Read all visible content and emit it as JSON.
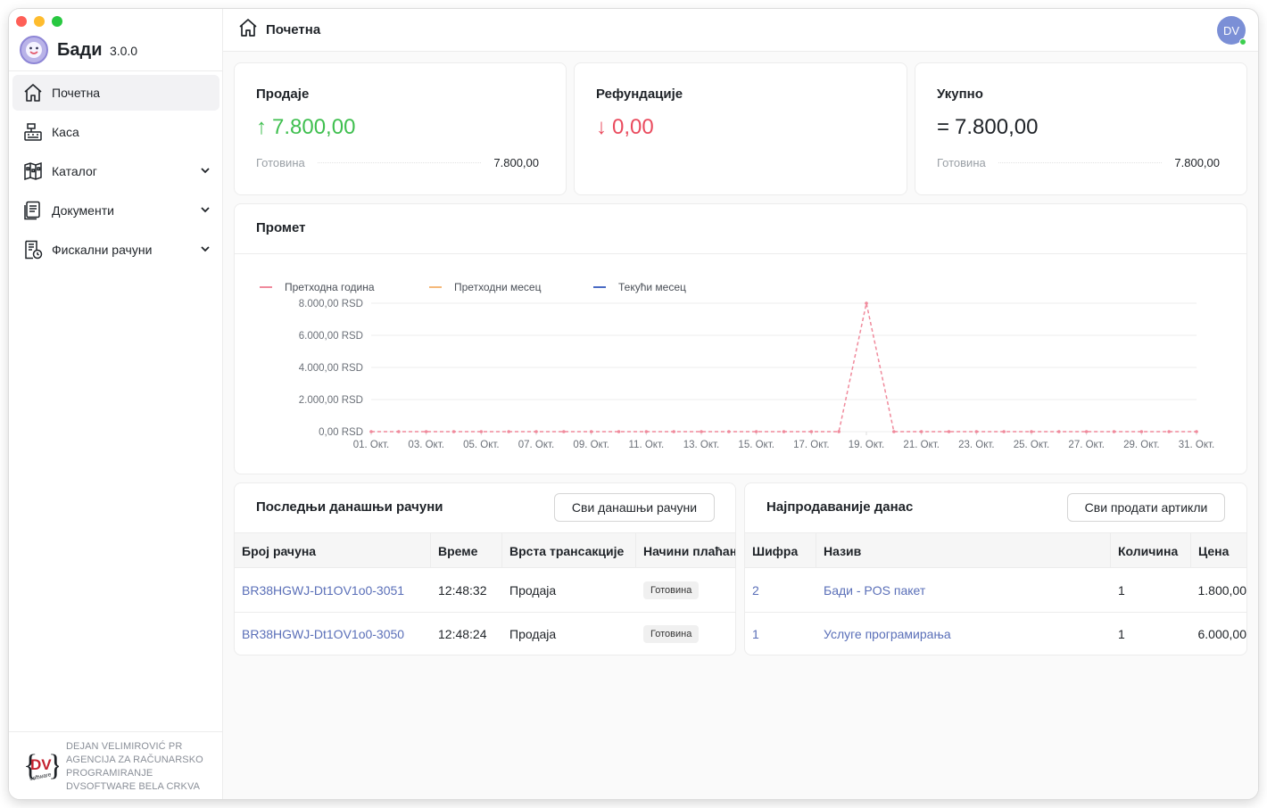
{
  "app": {
    "name": "Бади",
    "version": "3.0.0"
  },
  "nav": [
    {
      "label": "Почетна",
      "icon": "home-icon",
      "active": true,
      "expandable": false
    },
    {
      "label": "Каса",
      "icon": "cash-register-icon",
      "active": false,
      "expandable": false
    },
    {
      "label": "Каталог",
      "icon": "catalog-icon",
      "active": false,
      "expandable": true
    },
    {
      "label": "Документи",
      "icon": "documents-icon",
      "active": false,
      "expandable": true
    },
    {
      "label": "Фискални рачуни",
      "icon": "fiscal-receipt-icon",
      "active": false,
      "expandable": true
    }
  ],
  "footer": {
    "logo_text": "DV",
    "logo_sub": "software",
    "lines": [
      "DEJAN VELIMIROVIĆ PR",
      "AGENCIJA ZA RAČUNARSKO",
      "PROGRAMIRANJE",
      "DVSOFTWARE BELA CRKVA"
    ]
  },
  "header": {
    "title": "Почетна",
    "avatar_initials": "DV"
  },
  "stats": {
    "sales": {
      "title": "Продаје",
      "value": "7.800,00",
      "arrow": "↑",
      "row_label": "Готовина",
      "row_value": "7.800,00"
    },
    "refunds": {
      "title": "Рефундације",
      "value": "0,00",
      "arrow": "↓"
    },
    "total": {
      "title": "Укупно",
      "value": "7.800,00",
      "prefix": "=",
      "row_label": "Готовина",
      "row_value": "7.800,00"
    }
  },
  "promet": {
    "title": "Промет"
  },
  "chart_data": {
    "type": "line",
    "legend_position": "top-left",
    "series": [
      {
        "name": "Претходна година",
        "color": "#f08a9c",
        "values": [
          0,
          0,
          0,
          0,
          0,
          0,
          0,
          0,
          0,
          0,
          0,
          0,
          0,
          0,
          0,
          0,
          0,
          0,
          8000,
          0,
          0,
          0,
          0,
          0,
          0,
          0,
          0,
          0,
          0,
          0,
          0
        ]
      },
      {
        "name": "Претходни месец",
        "color": "#f5b97a",
        "values": []
      },
      {
        "name": "Текући месец",
        "color": "#4a6bc4",
        "values": []
      }
    ],
    "x_ticks": [
      "01. Окт.",
      "03. Окт.",
      "05. Окт.",
      "07. Окт.",
      "09. Окт.",
      "11. Окт.",
      "13. Окт.",
      "15. Окт.",
      "17. Окт.",
      "19. Окт.",
      "21. Окт.",
      "23. Окт.",
      "25. Окт.",
      "27. Окт.",
      "29. Окт.",
      "31. Окт."
    ],
    "y_ticks": [
      "0,00 RSD",
      "2.000,00 RSD",
      "4.000,00 RSD",
      "6.000,00 RSD",
      "8.000,00 RSD"
    ],
    "ylim": [
      0,
      8000
    ],
    "grid": true
  },
  "receipts": {
    "title": "Последњи данашњи рачуни",
    "button": "Сви данашњи рачуни",
    "columns": [
      "Број рачуна",
      "Време",
      "Врста трансакције",
      "Начини плаћања"
    ],
    "rows": [
      {
        "id": "BR38HGWJ-Dt1OV1o0-3051",
        "time": "12:48:32",
        "type": "Продаја",
        "payment": "Готовина"
      },
      {
        "id": "BR38HGWJ-Dt1OV1o0-3050",
        "time": "12:48:24",
        "type": "Продаја",
        "payment": "Готовина"
      }
    ]
  },
  "bestsellers": {
    "title": "Најпродаваније данас",
    "button": "Сви продати артикли",
    "columns": [
      "Шифра",
      "Назив",
      "Количина",
      "Цена"
    ],
    "rows": [
      {
        "code": "2",
        "name": "Бади - POS пакет",
        "qty": "1",
        "price": "1.800,00"
      },
      {
        "code": "1",
        "name": "Услуге програмирања",
        "qty": "1",
        "price": "6.000,00"
      }
    ]
  }
}
